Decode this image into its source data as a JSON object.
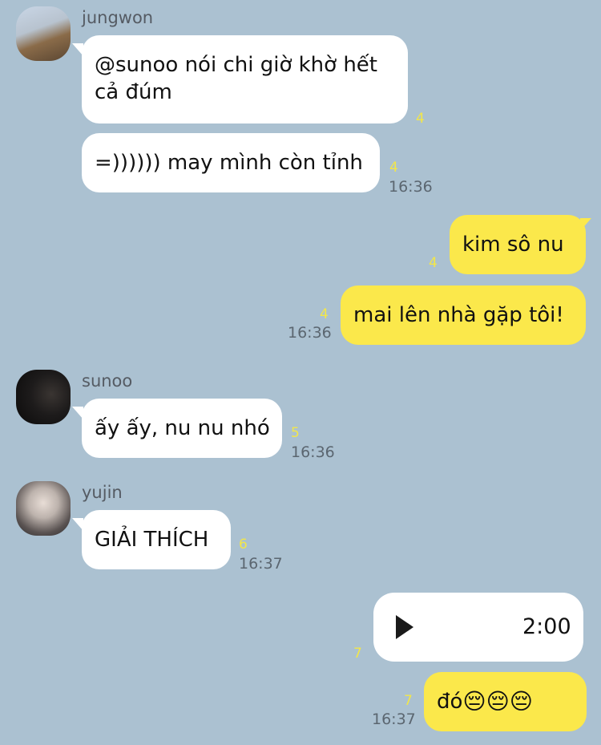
{
  "messages": [
    {
      "sender": "jungwon",
      "text": "@sunoo nói chi giờ khờ hết cả đúm",
      "unread": "4"
    },
    {
      "sender": "jungwon",
      "text": "=)))))) may mình còn tỉnh",
      "unread": "4",
      "time": "16:36"
    },
    {
      "sender": "me",
      "text": "kim sô nu",
      "unread": "4"
    },
    {
      "sender": "me",
      "text": "mai lên nhà gặp tôi!",
      "unread": "4",
      "time": "16:36"
    },
    {
      "sender": "sunoo",
      "text": "ấy ấy, nu nu nhó",
      "unread": "5",
      "time": "16:36"
    },
    {
      "sender": "yujin",
      "text": "GIẢI THÍCH",
      "unread": "6",
      "time": "16:37"
    },
    {
      "sender": "me",
      "type": "voice",
      "duration": "2:00",
      "unread": "7"
    },
    {
      "sender": "me",
      "text": "đó",
      "emoji": "😔😔😔",
      "unread": "7",
      "time": "16:37"
    }
  ],
  "icons": {
    "voice_play": "play-icon"
  },
  "colors": {
    "background": "#abc1d1",
    "outgoing": "#fbe84b",
    "incoming": "#ffffff",
    "unread": "#f2e64a"
  }
}
